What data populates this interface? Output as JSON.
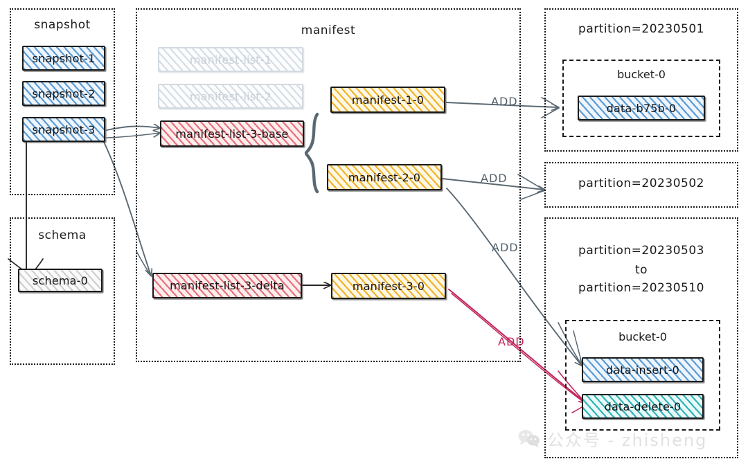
{
  "regions": {
    "snapshot": {
      "title": "snapshot"
    },
    "schema": {
      "title": "schema"
    },
    "manifest": {
      "title": "manifest"
    },
    "partition_1": {
      "title": "partition=20230501"
    },
    "partition_2": {
      "title": "partition=20230502"
    },
    "partition_3": {
      "title_line1": "partition=20230503",
      "title_line2": "to",
      "title_line3": "partition=20230510"
    }
  },
  "buckets": {
    "bucket_top": {
      "title": "bucket-0"
    },
    "bucket_bottom": {
      "title": "bucket-0"
    }
  },
  "nodes": {
    "snapshot_1": {
      "label": "snapshot-1"
    },
    "snapshot_2": {
      "label": "snapshot-2"
    },
    "snapshot_3": {
      "label": "snapshot-3"
    },
    "schema_0": {
      "label": "schema-0"
    },
    "manifest_list_1": {
      "label": "manifest-list-1"
    },
    "manifest_list_2": {
      "label": "manifest-list-2"
    },
    "manifest_list_3_base": {
      "label": "manifest-list-3-base"
    },
    "manifest_list_3_delta": {
      "label": "manifest-list-3-delta"
    },
    "manifest_1_0": {
      "label": "manifest-1-0"
    },
    "manifest_2_0": {
      "label": "manifest-2-0"
    },
    "manifest_3_0": {
      "label": "manifest-3-0"
    },
    "data_b75b_0": {
      "label": "data-b75b-0"
    },
    "data_insert_0": {
      "label": "data-insert-0"
    },
    "data_delete_0": {
      "label": "data-delete-0"
    }
  },
  "edge_labels": {
    "add_1": "ADD",
    "add_2": "ADD",
    "add_3": "ADD",
    "add_4": "ADD"
  },
  "watermark": {
    "text": "公众号 - zhisheng"
  },
  "colors": {
    "blue_hatch": "#5b9bd5",
    "yellow_hatch": "#f0b429",
    "red_hatch": "#e8707a",
    "teal_hatch": "#2fb3b8",
    "grey_hatch": "#cfcfcf",
    "arrow_grey": "#5a6872",
    "arrow_pink": "#c2255c",
    "outline": "#1a1a1a"
  }
}
